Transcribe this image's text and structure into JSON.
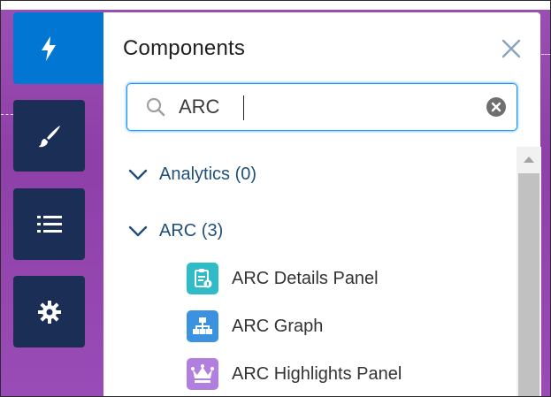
{
  "panel": {
    "title": "Components"
  },
  "search": {
    "value": "ARC",
    "placeholder": ""
  },
  "groups": [
    {
      "label": "Analytics (0)"
    },
    {
      "label": "ARC (3)"
    }
  ],
  "items": [
    {
      "label": "ARC Details Panel",
      "icon": "details-panel-icon",
      "color": "#2fbcc7"
    },
    {
      "label": "ARC Graph",
      "icon": "hierarchy-icon",
      "color": "#3b93e0"
    },
    {
      "label": "ARC Highlights Panel",
      "icon": "crown-icon",
      "color": "#b07fe0"
    }
  ],
  "rail": [
    {
      "icon": "lightning-icon",
      "active": true
    },
    {
      "icon": "brush-icon",
      "active": false
    },
    {
      "icon": "list-icon",
      "active": false
    },
    {
      "icon": "gear-icon",
      "active": false
    }
  ],
  "colors": {
    "accent": "#0176d3",
    "rail": "#1b2e56",
    "group_text": "#1f4f7a",
    "background": "#9b4fb2"
  }
}
